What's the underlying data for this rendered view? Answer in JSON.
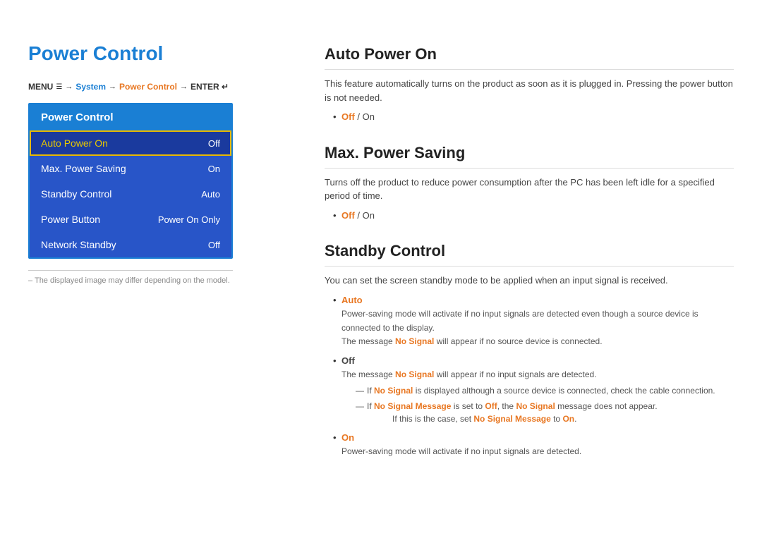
{
  "left": {
    "title": "Power Control",
    "breadcrumb": {
      "menu": "MENU",
      "menu_icon": "☰",
      "arrow1": "→",
      "system": "System",
      "arrow2": "→",
      "power_control": "Power Control",
      "arrow3": "→",
      "enter": "ENTER",
      "enter_icon": "↵"
    },
    "menu_header": "Power Control",
    "menu_items": [
      {
        "label": "Auto Power On",
        "value": "Off",
        "selected": true
      },
      {
        "label": "Max. Power Saving",
        "value": "On",
        "selected": false
      },
      {
        "label": "Standby Control",
        "value": "Auto",
        "selected": false
      },
      {
        "label": "Power Button",
        "value": "Power On Only",
        "selected": false
      },
      {
        "label": "Network Standby",
        "value": "Off",
        "selected": false
      }
    ],
    "footnote": "– The displayed image may differ depending on the model."
  },
  "right": {
    "sections": [
      {
        "id": "auto-power-on",
        "title": "Auto Power On",
        "desc": "This feature automatically turns on the product as soon as it is plugged in. Pressing the power button is not needed.",
        "bullets": [
          {
            "text": "Off / On",
            "highlight": [
              {
                "word": "Off",
                "type": "orange"
              },
              {
                "word": "On",
                "type": "plain"
              }
            ]
          }
        ]
      },
      {
        "id": "max-power-saving",
        "title": "Max. Power Saving",
        "desc": "Turns off the product to reduce power consumption after the PC has been left idle for a specified period of time.",
        "bullets": [
          {
            "text": "Off / On",
            "highlight": [
              {
                "word": "Off",
                "type": "orange"
              }
            ]
          }
        ]
      },
      {
        "id": "standby-control",
        "title": "Standby Control",
        "desc": "You can set the screen standby mode to be applied when an input signal is received.",
        "bullets": [
          {
            "label": "Auto",
            "label_color": "orange",
            "body": "Power-saving mode will activate if no input signals are detected even though a source device is connected to the display.\nThe message No Signal will appear if no source device is connected."
          },
          {
            "label": "Off",
            "label_color": "plain",
            "body": "The message No Signal will appear if no input signals are detected.",
            "subnotes": [
              "If No Signal is displayed although a source device is connected, check the cable connection.",
              "If No Signal Message is set to Off, the No Signal message does not appear.\n            If this is the case, set No Signal Message to On."
            ]
          },
          {
            "label": "On",
            "label_color": "orange",
            "body": "Power-saving mode will activate if no input signals are detected."
          }
        ]
      }
    ]
  }
}
